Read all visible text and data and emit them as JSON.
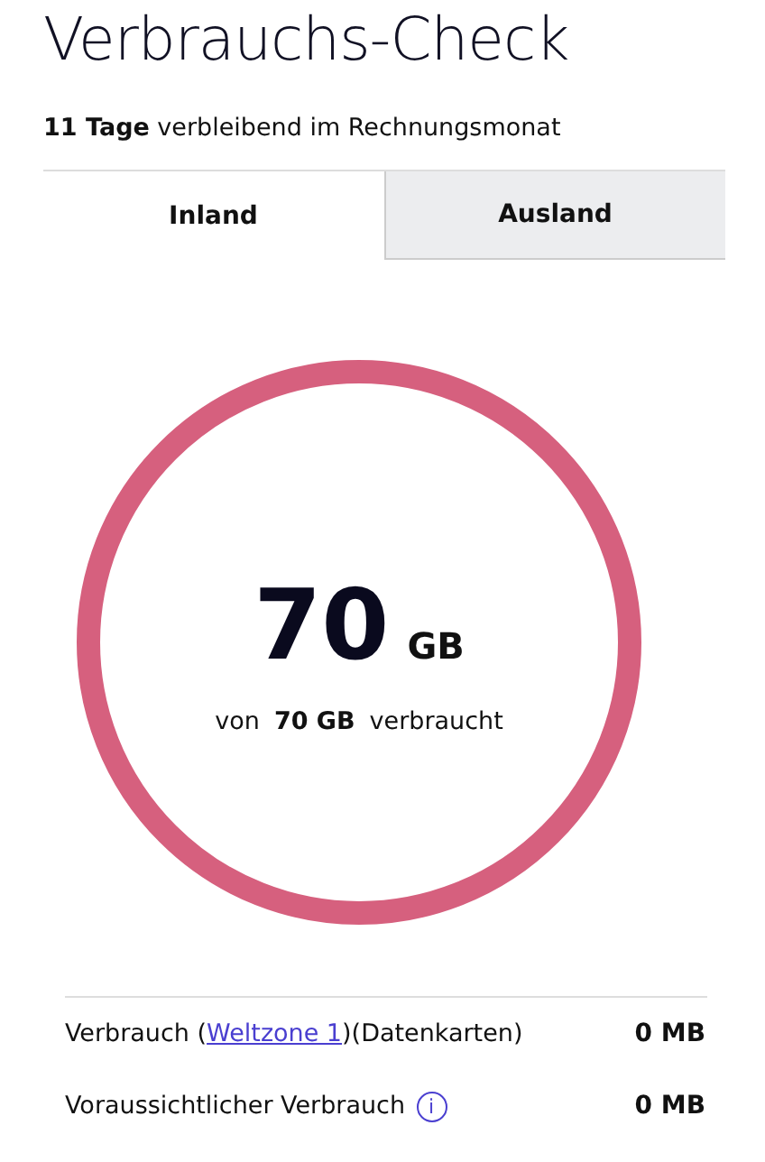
{
  "title": "Verbrauchs-Check",
  "remaining": {
    "days": "11 Tage",
    "text": "verbleibend im Rechnungsmonat"
  },
  "tabs": [
    {
      "label": "Inland",
      "selected": true
    },
    {
      "label": "Ausland",
      "selected": false
    }
  ],
  "usage": {
    "level": 1,
    "amount": "70",
    "unit": "GB",
    "of": "von",
    "total": "70 GB",
    "used": "verbraucht"
  },
  "rows": [
    {
      "kind": "link",
      "before": "Verbrauch (",
      "link": "Weltzone 1",
      "after": ")(Datenkarten)",
      "value": "0 MB"
    },
    {
      "kind": "info",
      "label": "Voraussichtlicher Verbrauch",
      "info": "i",
      "value": "0 MB"
    }
  ]
}
